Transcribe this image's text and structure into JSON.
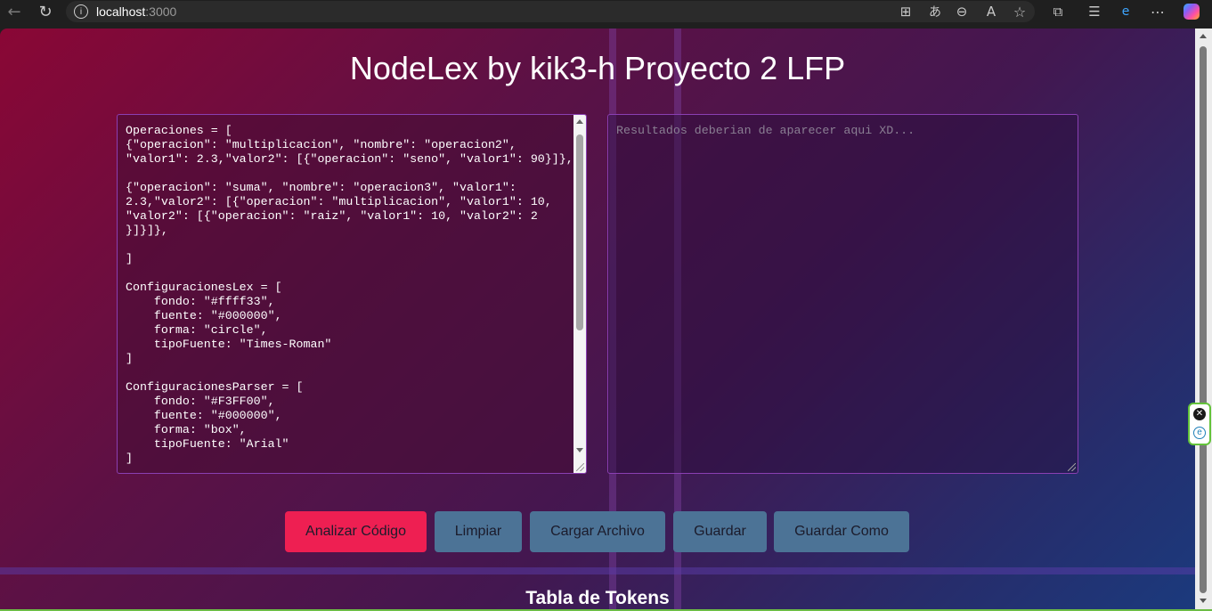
{
  "browser": {
    "url_host": "localhost",
    "url_port": ":3000",
    "icons": [
      "back-arrow-icon",
      "reload-icon",
      "info-icon",
      "split-screen-icon",
      "read-aloud-icon",
      "zoom-out-icon",
      "text-size-icon",
      "favorite-star-icon",
      "extensions-icon",
      "favorites-list-icon",
      "edge-icon",
      "more-icon",
      "copilot-icon"
    ]
  },
  "page": {
    "title": "NodeLex by kik3-h Proyecto 2 LFP",
    "code_input": "Operaciones = [\n{\"operacion\": \"multiplicacion\", \"nombre\": \"operacion2\", \"valor1\": 2.3,\"valor2\": [{\"operacion\": \"seno\", \"valor1\": 90}]},\n\n{\"operacion\": \"suma\", \"nombre\": \"operacion3\", \"valor1\": 2.3,\"valor2\": [{\"operacion\": \"multiplicacion\", \"valor1\": 10, \"valor2\": [{\"operacion\": \"raiz\", \"valor1\": 10, \"valor2\": 2 }]}]},\n\n]\n\nConfiguracionesLex = [\n    fondo: \"#ffff33\",\n    fuente: \"#000000\",\n    forma: \"circle\",\n    tipoFuente: \"Times-Roman\"\n]\n\nConfiguracionesParser = [\n    fondo: \"#F3FF00\",\n    fuente: \"#000000\",\n    forma: \"box\",\n    tipoFuente: \"Arial\"\n]",
    "output_placeholder": "Resultados deberian de aparecer aqui XD...",
    "buttons": {
      "analyze": "Analizar Código",
      "clear": "Limpiar",
      "load": "Cargar Archivo",
      "save": "Guardar",
      "save_as": "Guardar Como"
    },
    "tokens_title": "Tabla de Tokens"
  },
  "colors": {
    "accent": "#ee1f52",
    "button": "#4c7396",
    "gradient_start": "#8a0735",
    "gradient_end": "#1b3a7d"
  }
}
